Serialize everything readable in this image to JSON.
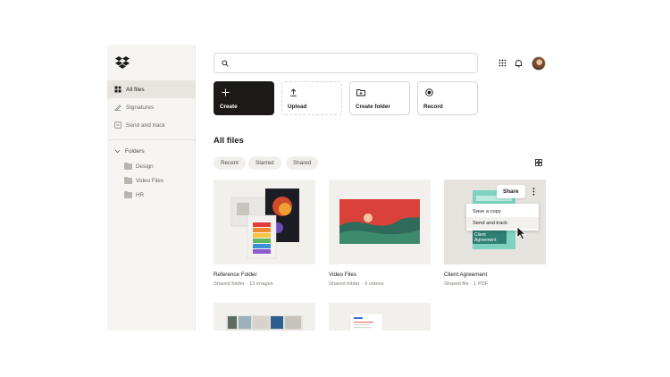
{
  "sidebar": {
    "items": [
      {
        "label": "All files",
        "icon": "all-files-icon",
        "active": true
      },
      {
        "label": "Signatures",
        "icon": "signature-icon",
        "active": false
      },
      {
        "label": "Send and track",
        "icon": "send-track-icon",
        "active": false
      }
    ],
    "folders_label": "Folders",
    "folders": [
      "Design",
      "Video Files",
      "HR"
    ]
  },
  "search": {
    "placeholder": ""
  },
  "actions": [
    {
      "label": "Create",
      "icon": "plus-icon"
    },
    {
      "label": "Upload",
      "icon": "upload-icon"
    },
    {
      "label": "Create folder",
      "icon": "new-folder-icon"
    },
    {
      "label": "Record",
      "icon": "record-icon"
    }
  ],
  "main": {
    "title": "All files",
    "filters": [
      "Recent",
      "Starred",
      "Shared"
    ]
  },
  "cards": [
    {
      "title": "Reference Folder",
      "subtitle": "Shared folder · 13 images"
    },
    {
      "title": "Video Files",
      "subtitle": "Shared folder · 3 videos"
    },
    {
      "title": "Client Agreement",
      "subtitle": "Shared file · 1 PDF"
    }
  ],
  "card3_overlay": {
    "share_label": "Share",
    "menu": [
      "Save a copy",
      "Send and track"
    ],
    "doc_text": "Client Agreement"
  },
  "colors": {
    "accent_dark": "#1e1919",
    "sidebar_bg": "#f7f5f2",
    "doc_teal": "#2f7f73"
  }
}
